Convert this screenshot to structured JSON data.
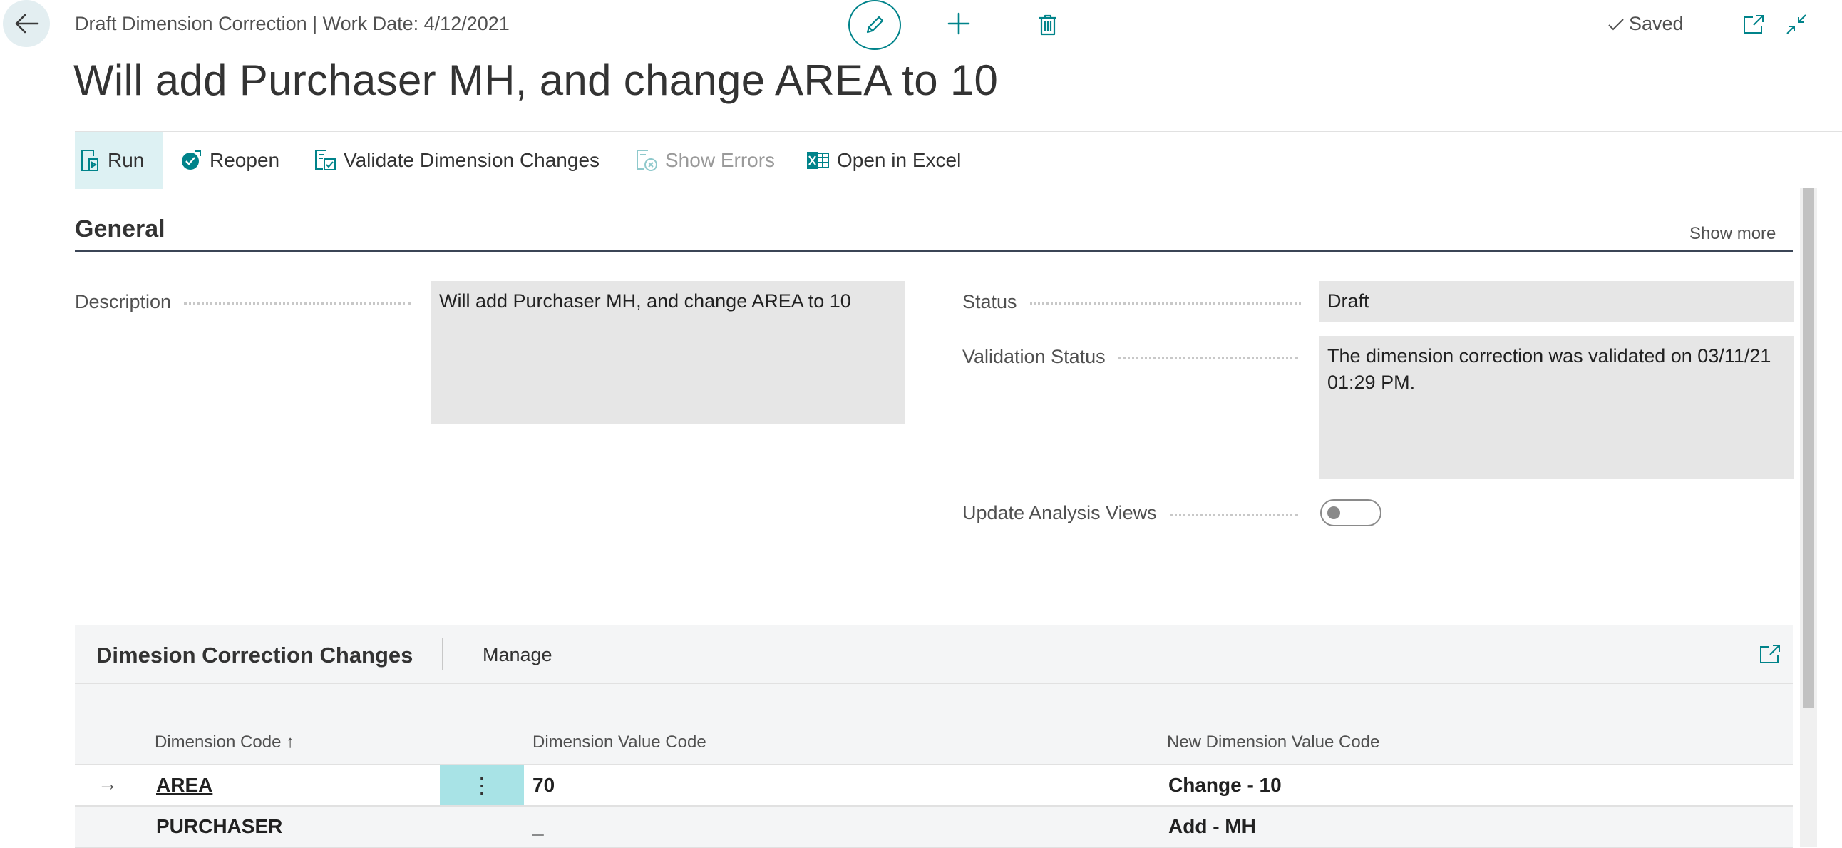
{
  "header": {
    "caption": "Draft Dimension Correction | Work Date: 4/12/2021",
    "title": "Will add Purchaser MH, and change AREA to 10",
    "saved_label": "Saved"
  },
  "actions": [
    {
      "label": "Run",
      "icon": "run-icon"
    },
    {
      "label": "Reopen",
      "icon": "reopen-icon"
    },
    {
      "label": "Validate Dimension Changes",
      "icon": "validate-icon"
    },
    {
      "label": "Show Errors",
      "icon": "show-errors-icon"
    },
    {
      "label": "Open in Excel",
      "icon": "excel-icon"
    }
  ],
  "general": {
    "title": "General",
    "show_more": "Show more",
    "description_label": "Description",
    "description_value": "Will add Purchaser MH, and change AREA to 10",
    "status_label": "Status",
    "status_value": "Draft",
    "validation_status_label": "Validation Status",
    "validation_status_value": "The dimension correction was validated on 03/11/21 01:29 PM.",
    "update_analysis_views_label": "Update Analysis Views",
    "update_analysis_views_value": false
  },
  "lines": {
    "title": "Dimesion Correction Changes",
    "manage_label": "Manage",
    "columns": {
      "dimension_code": "Dimension Code ↑",
      "dimension_value_code": "Dimension Value Code",
      "new_dimension_value_code": "New Dimension Value Code"
    },
    "rows": [
      {
        "dimension_code": "AREA",
        "dimension_value_code": "70",
        "new_dimension_value_code": "Change - 10"
      },
      {
        "dimension_code": "PURCHASER",
        "dimension_value_code": "_",
        "new_dimension_value_code": "Add - MH"
      }
    ]
  },
  "colors": {
    "accent": "#00838a",
    "selected_row": "#a8e3e6",
    "field_background": "#e6e6e6"
  }
}
